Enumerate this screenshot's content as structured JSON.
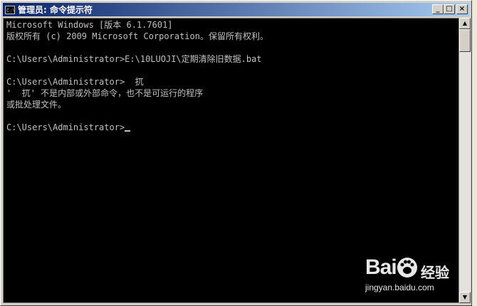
{
  "window": {
    "title": "管理员: 命令提示符",
    "icon_label": "C:\\",
    "buttons": {
      "minimize": "_",
      "maximize": "□",
      "close": "×"
    }
  },
  "console": {
    "lines": [
      "Microsoft Windows [版本 6.1.7601]",
      "版权所有 (c) 2009 Microsoft Corporation。保留所有权利。",
      "",
      "C:\\Users\\Administrator>E:\\10LUOJI\\定期清除旧数据.bat",
      "",
      "C:\\Users\\Administrator>  扤",
      "'  扤' 不是内部或外部命令，也不是可运行的程序",
      "或批处理文件。",
      "",
      "C:\\Users\\Administrator>"
    ]
  },
  "scrollbar": {
    "up": "▲",
    "down": "▼"
  },
  "watermark": {
    "brand_left": "Bai",
    "brand_cn": "经验",
    "url": "jingyan.baidu.com"
  },
  "colors": {
    "titlebar_start": "#0a246a",
    "titlebar_end": "#a6caf0",
    "console_bg": "#000000",
    "console_text": "#c0c0c0"
  }
}
